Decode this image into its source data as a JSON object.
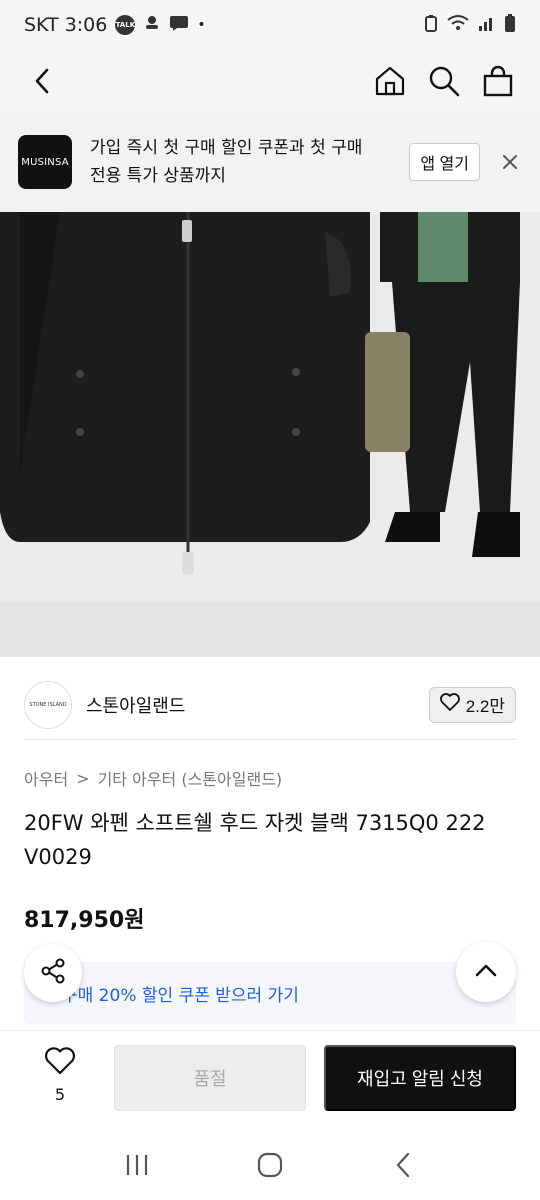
{
  "status": {
    "carrier_time": "SKT 3:06",
    "talk_badge": "TALK",
    "dot": "•"
  },
  "banner": {
    "logo_text": "MUSINSA",
    "message": "가입 즉시 첫 구매 할인 쿠폰과 첫 구매 전용 특가 상품까지",
    "open_app": "앱 열기"
  },
  "brand": {
    "logo_text": "STONE ISLAND",
    "name": "스톤아일랜드",
    "likes": "2.2만"
  },
  "breadcrumb": {
    "category": "아우터",
    "separator": ">",
    "subcategory": "기타 아우터 (스톤아일랜드)"
  },
  "product": {
    "title": "20FW 와펜 소프트쉘 후드 자켓 블랙 7315Q0 222 V0029",
    "price": "817,950원"
  },
  "coupon": {
    "label": "구매 20% 할인 쿠폰 받으러 가기"
  },
  "bottom": {
    "wish_count": "5",
    "soldout_label": "품절",
    "restock_label": "재입고 알림 신청"
  },
  "colors": {
    "accent_blue": "#1e5fd8",
    "primary_black": "#111111",
    "disabled_gray": "#ededed"
  },
  "icons": [
    "back-icon",
    "home-icon",
    "search-icon",
    "bag-icon",
    "close-icon",
    "heart-icon",
    "share-icon",
    "chevron-up-icon",
    "recent-apps-icon",
    "home-nav-icon",
    "back-nav-icon"
  ]
}
